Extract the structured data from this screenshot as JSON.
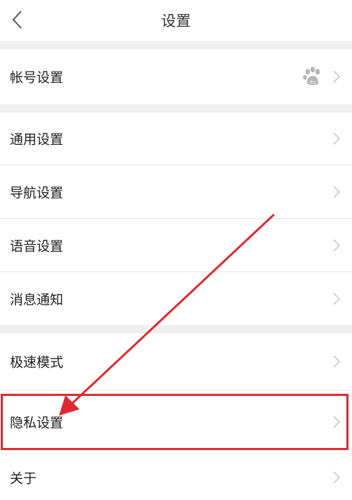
{
  "header": {
    "title": "设置"
  },
  "sections": [
    {
      "items": [
        {
          "label": "帐号设置",
          "avatar_icon": "baidu-paw-icon"
        }
      ]
    },
    {
      "items": [
        {
          "label": "通用设置"
        },
        {
          "label": "导航设置"
        },
        {
          "label": "语音设置"
        },
        {
          "label": "消息通知"
        }
      ]
    },
    {
      "items": [
        {
          "label": "极速模式"
        },
        {
          "label": "隐私设置"
        },
        {
          "label": "关于"
        }
      ]
    }
  ],
  "annotation": {
    "color": "#e0282d",
    "highlighted_item": "隐私设置"
  }
}
